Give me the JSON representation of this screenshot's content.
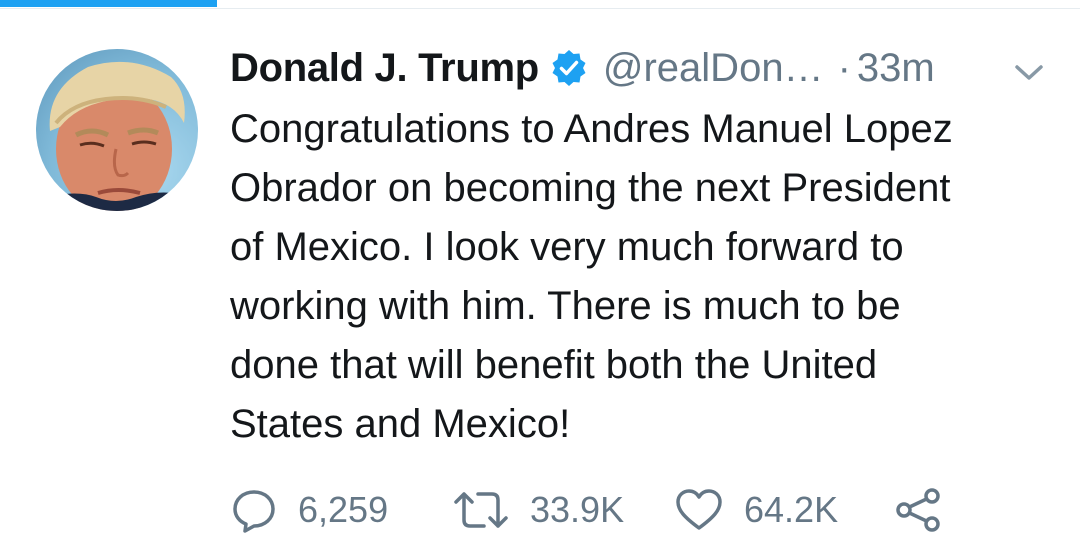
{
  "colors": {
    "accent": "#1da1f2",
    "text_primary": "#14171a",
    "text_secondary": "#657786"
  },
  "tweet": {
    "author_name": "Donald J. Trump",
    "verified_icon": "verified-badge-icon",
    "handle": "@realDon…",
    "separator": "·",
    "timestamp": "33m",
    "menu_icon": "chevron-down-icon",
    "avatar_icon": "profile-avatar",
    "text_lines": [
      "Congratulations to Andres Manuel Lopez",
      "Obrador on becoming the next President",
      "of Mexico. I look very much forward to",
      "working with him. There is much to be",
      "done that will benefit both the United",
      "States and Mexico!"
    ]
  },
  "actions": {
    "reply": {
      "icon": "reply-icon",
      "count": "6,259"
    },
    "retweet": {
      "icon": "retweet-icon",
      "count": "33.9K"
    },
    "like": {
      "icon": "heart-icon",
      "count": "64.2K"
    },
    "share": {
      "icon": "share-icon"
    }
  }
}
